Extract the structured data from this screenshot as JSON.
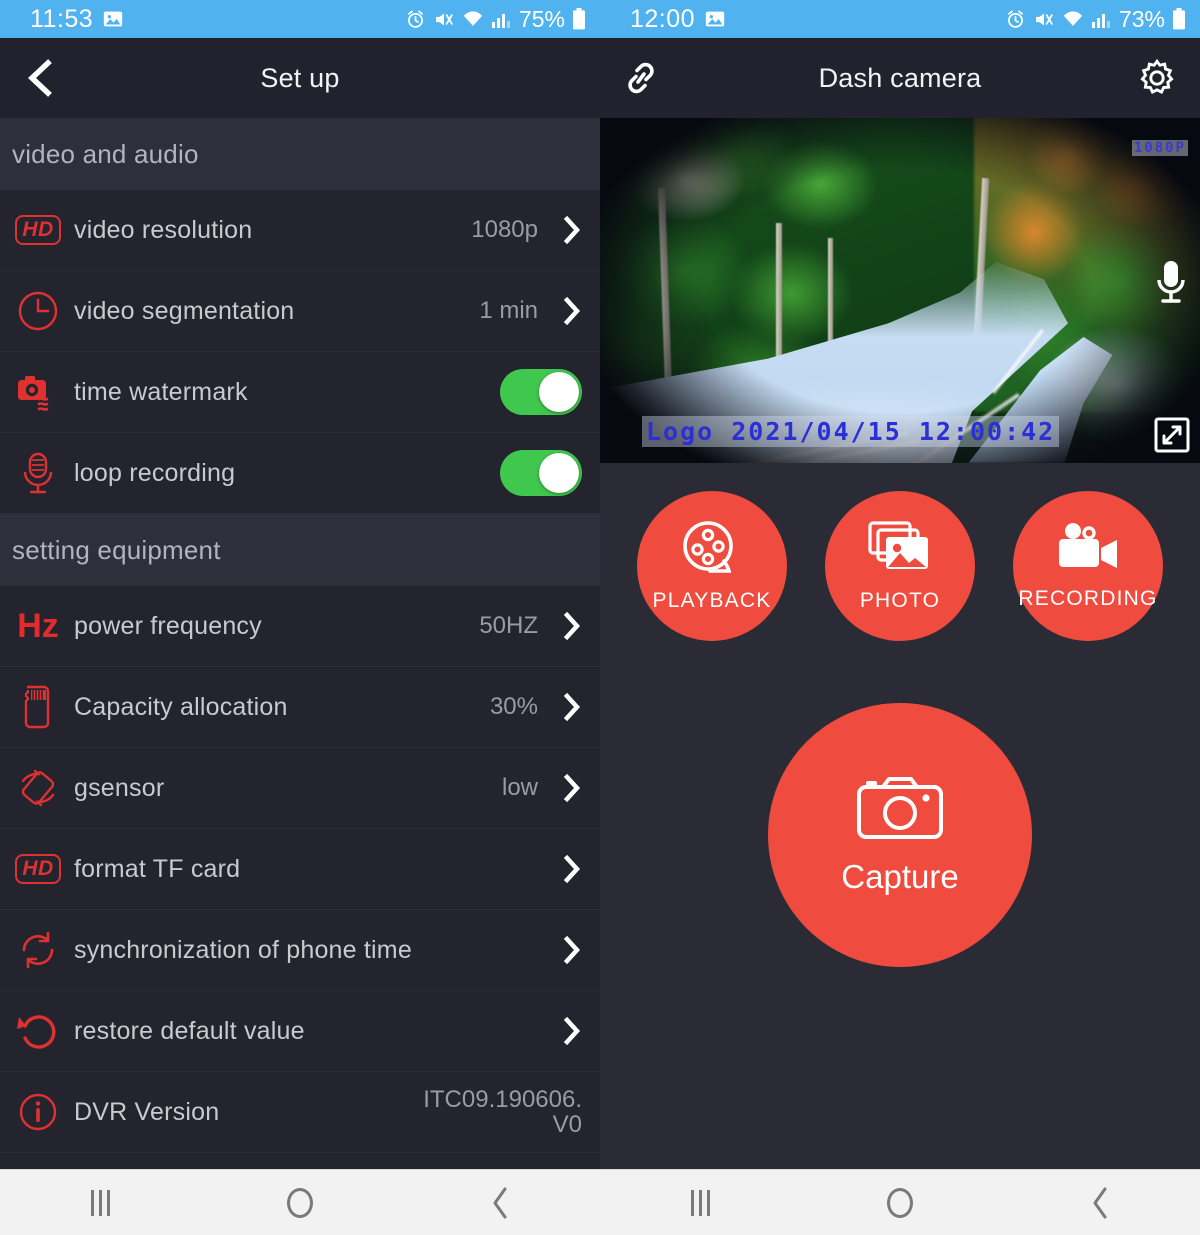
{
  "left": {
    "status": {
      "time": "11:53",
      "battery_pct": "75%",
      "icons": [
        "image-icon",
        "alarm-icon",
        "mute-icon",
        "wifi-icon",
        "signal-icon",
        "battery-icon"
      ]
    },
    "header": {
      "title": "Set up",
      "back_icon": "back-chevron-icon"
    },
    "sections": [
      {
        "title": "video and audio",
        "rows": [
          {
            "icon": "hd-badge-icon",
            "label": "video resolution",
            "value": "1080p",
            "type": "chevron"
          },
          {
            "icon": "clock-icon",
            "label": "video segmentation",
            "value": "1 min",
            "type": "chevron"
          },
          {
            "icon": "camera-watermark-icon",
            "label": "time watermark",
            "value": "",
            "type": "toggle",
            "on": true
          },
          {
            "icon": "microphone-icon",
            "label": "loop recording",
            "value": "",
            "type": "toggle",
            "on": true
          }
        ]
      },
      {
        "title": "setting equipment",
        "rows": [
          {
            "icon": "hz-icon",
            "label": "power frequency",
            "value": "50HZ",
            "type": "chevron"
          },
          {
            "icon": "sd-card-icon",
            "label": "Capacity allocation",
            "value": "30%",
            "type": "chevron"
          },
          {
            "icon": "gsensor-icon",
            "label": "gsensor",
            "value": "low",
            "type": "chevron"
          },
          {
            "icon": "hd-badge-icon",
            "label": "format TF card",
            "value": "",
            "type": "chevron"
          },
          {
            "icon": "sync-icon",
            "label": "synchronization of phone time",
            "value": "",
            "type": "chevron"
          },
          {
            "icon": "restore-icon",
            "label": "restore default value",
            "value": "",
            "type": "chevron"
          },
          {
            "icon": "info-icon",
            "label": "DVR Version",
            "value": "ITC09.190606.V0",
            "type": "text"
          }
        ]
      }
    ]
  },
  "right": {
    "status": {
      "time": "12:00",
      "battery_pct": "73%",
      "icons": [
        "image-icon",
        "alarm-icon",
        "mute-icon",
        "wifi-icon",
        "signal-icon",
        "battery-icon"
      ]
    },
    "header": {
      "title": "Dash camera",
      "link_icon": "link-icon",
      "settings_icon": "gear-icon"
    },
    "video": {
      "resolution_badge": "1080P",
      "watermark": "Logo 2021/04/15 12:00:42",
      "mic_icon": "microphone-icon",
      "fullscreen_icon": "expand-icon"
    },
    "actions": [
      {
        "label": "PLAYBACK",
        "icon": "film-reel-icon"
      },
      {
        "label": "PHOTO",
        "icon": "photo-stack-icon"
      },
      {
        "label": "RECORDING",
        "icon": "video-camera-icon"
      }
    ],
    "capture": {
      "label": "Capture",
      "icon": "camera-icon"
    }
  },
  "navbar": {
    "recents": "recents-icon",
    "home": "home-icon",
    "back": "back-icon"
  },
  "colors": {
    "status_bar": "#50b3ef",
    "app_bar": "#22222e",
    "list_bg": "#24242e",
    "section_bg": "#2f2f3c",
    "accent_red": "#e03131",
    "button_red": "#ef4b3f",
    "toggle_green": "#3fc74e",
    "watermark_blue": "#2b2fd6"
  }
}
